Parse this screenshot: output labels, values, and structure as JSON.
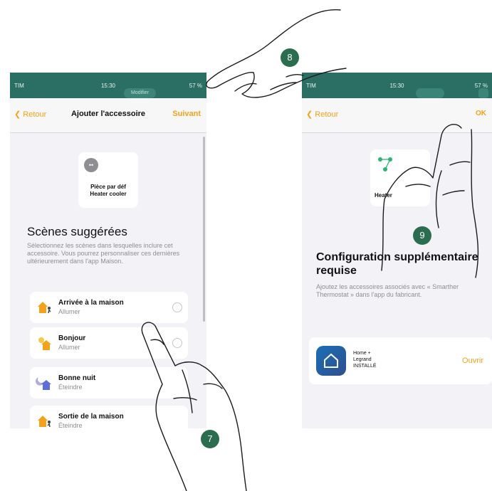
{
  "left_screen": {
    "status": {
      "carrier": "TIM",
      "time": "15:30",
      "battery": "57 %"
    },
    "top_button": "Modifier",
    "nav": {
      "back": "Retour",
      "title": "Ajouter l'accessoire",
      "next": "Suivant"
    },
    "accessory": {
      "room": "Pièce par déf",
      "name": "Heater cooler"
    },
    "scenes_title": "Scènes suggérées",
    "scenes_description": "Sélectionnez les scènes dans lesquelles inclure cet accessoire. Vous pourrez personnaliser ces dernières ultérieurement dans l'app Maison.",
    "scenes": [
      {
        "name": "Arrivée à la maison",
        "state": "Allumer",
        "icon": "house-arrive-icon"
      },
      {
        "name": "Bonjour",
        "state": "Allumer",
        "icon": "sun-house-icon"
      },
      {
        "name": "Bonne nuit",
        "state": "Éteindre",
        "icon": "moon-house-icon"
      },
      {
        "name": "Sortie de la maison",
        "state": "Éteindre",
        "icon": "house-leave-icon"
      }
    ]
  },
  "right_screen": {
    "status": {
      "carrier": "TIM",
      "time": "15:30",
      "battery": "57 %"
    },
    "nav": {
      "back": "Retour",
      "done": "OK"
    },
    "accessory": {
      "name": "Heater"
    },
    "config_title": "Configuration supplémentaire requise",
    "config_description": "Ajoutez les accessoires associés avec « Smarther Thermostat » dans l'app du fabricant.",
    "app": {
      "line1": "Home +",
      "line2": "Legrand",
      "line3": "INSTALLÉ",
      "action": "Ouvrir"
    }
  },
  "step_badges": [
    "7",
    "8",
    "9"
  ],
  "colors": {
    "accent": "#f5a21b",
    "badge": "#2b6e4f",
    "status_bar": "#2a6e64"
  }
}
